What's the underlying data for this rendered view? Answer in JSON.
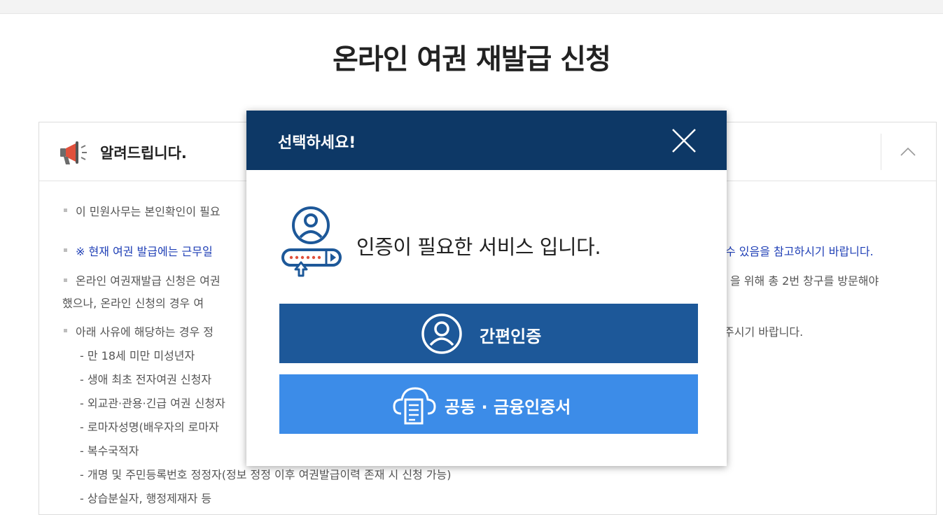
{
  "page": {
    "title": "온라인 여권 재발급 신청"
  },
  "notice": {
    "title": "알려드립니다.",
    "lines": [
      "이 민원사무는 본인확인이 필요",
      "※ 현재 여권 발급에는 근무일",
      "수 있음을 참고하시기 바랍니다.",
      "온라인 여권재발급 신청은 여권",
      "을 위해 총 2번 창구를 방문해야",
      "했으나, 온라인 신청의 경우 여",
      "아래 사유에 해당하는 경우 정",
      "주시기 바랍니다."
    ],
    "sub_items": [
      "- 만 18세 미만 미성년자",
      "- 생애 최초 전자여권 신청자",
      "- 외교관·관용·긴급 여권 신청자",
      "- 로마자성명(배우자의 로마자",
      "- 복수국적자",
      "- 개명 및 주민등록번호 정정자(정보 정정 이후 여권발급이력 존재 시 신청 가능)",
      "- 상습분실자, 행정제재자 등"
    ]
  },
  "modal": {
    "title": "선택하세요!",
    "message": "인증이 필요한 서비스 입니다.",
    "buttons": {
      "simple_auth": "간편인증",
      "joint_cert": "공동 · 금융인증서"
    }
  },
  "colors": {
    "modal_header": "#0d3866",
    "simple_auth_button": "#1d5899",
    "joint_cert_button": "#3c8ce8",
    "notice_blue_text": "#1f3fb6",
    "megaphone_accent": "#e0503c"
  },
  "icons": [
    "megaphone-icon",
    "chevron-up-icon",
    "close-icon",
    "user-auth-icon",
    "user-circle-icon",
    "cloud-document-icon"
  ]
}
